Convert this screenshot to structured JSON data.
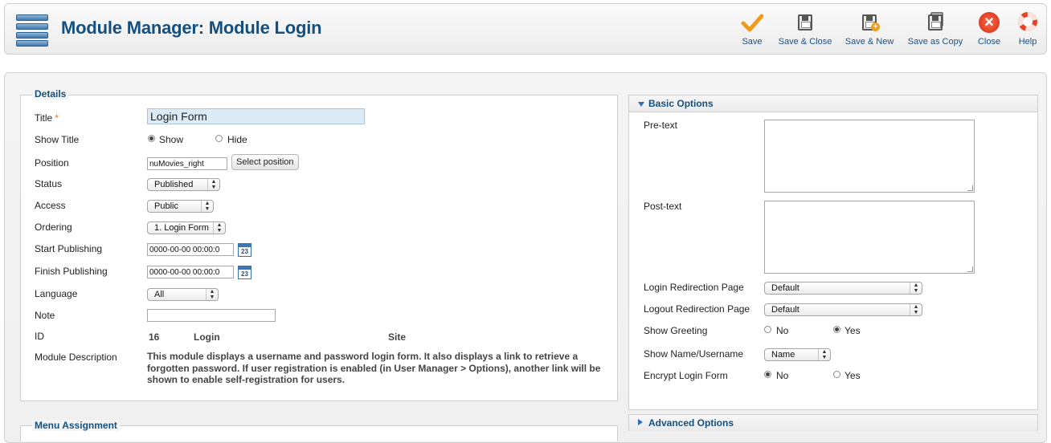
{
  "header": {
    "title": "Module Manager: Module Login"
  },
  "toolbar": {
    "save": "Save",
    "save_close": "Save & Close",
    "save_new": "Save & New",
    "save_copy": "Save as Copy",
    "close": "Close",
    "help": "Help"
  },
  "details": {
    "legend": "Details",
    "title_label": "Title",
    "title_required": "*",
    "title_value": "Login Form",
    "show_title_label": "Show Title",
    "show_title_options": [
      "Show",
      "Hide"
    ],
    "show_title_selected": "Show",
    "position_label": "Position",
    "position_value": "nuMovies_right",
    "select_position_button": "Select position",
    "status_label": "Status",
    "status_value": "Published",
    "access_label": "Access",
    "access_value": "Public",
    "ordering_label": "Ordering",
    "ordering_value": "1. Login Form",
    "start_publishing_label": "Start Publishing",
    "start_publishing_value": "0000-00-00 00:00:0",
    "finish_publishing_label": "Finish Publishing",
    "finish_publishing_value": "0000-00-00 00:00:0",
    "calendar_day": "23",
    "language_label": "Language",
    "language_value": "All",
    "note_label": "Note",
    "note_value": "",
    "id_label": "ID",
    "id_value": "16",
    "module_name": "Login",
    "client": "Site",
    "description_label": "Module Description",
    "description_text": "This module displays a username and password login form. It also displays a link to retrieve a forgotten password. If user registration is enabled (in User Manager > Options), another link will be shown to enable self-registration for users."
  },
  "menu_assignment": {
    "legend": "Menu Assignment"
  },
  "basic_options": {
    "title": "Basic Options",
    "pretext_label": "Pre-text",
    "posttext_label": "Post-text",
    "login_redirect_label": "Login Redirection Page",
    "login_redirect_value": "Default",
    "logout_redirect_label": "Logout Redirection Page",
    "logout_redirect_value": "Default",
    "show_greeting_label": "Show Greeting",
    "show_greeting_options": [
      "No",
      "Yes"
    ],
    "show_greeting_selected": "Yes",
    "show_name_label": "Show Name/Username",
    "show_name_value": "Name",
    "encrypt_label": "Encrypt Login Form",
    "encrypt_options": [
      "No",
      "Yes"
    ],
    "encrypt_selected": "No"
  },
  "advanced_options": {
    "title": "Advanced Options"
  },
  "colors": {
    "accent": "#14507f",
    "title_field_bg": "#ddebf6",
    "close_red": "#d02a12"
  }
}
